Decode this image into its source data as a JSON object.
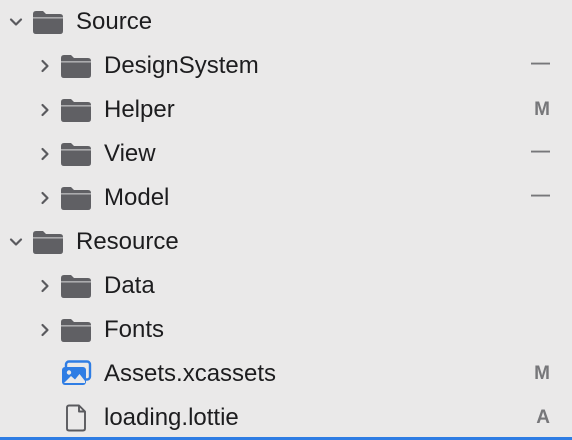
{
  "navigator": {
    "rows": [
      {
        "label": "Source",
        "status": "",
        "icon": "folder-icon",
        "expanded": true
      },
      {
        "label": "DesignSystem",
        "status": "—",
        "icon": "folder-icon",
        "expanded": false
      },
      {
        "label": "Helper",
        "status": "M",
        "icon": "folder-icon",
        "expanded": false
      },
      {
        "label": "View",
        "status": "—",
        "icon": "folder-icon",
        "expanded": false
      },
      {
        "label": "Model",
        "status": "—",
        "icon": "folder-icon",
        "expanded": false
      },
      {
        "label": "Resource",
        "status": "",
        "icon": "folder-icon",
        "expanded": true
      },
      {
        "label": "Data",
        "status": "",
        "icon": "folder-icon",
        "expanded": false
      },
      {
        "label": "Fonts",
        "status": "",
        "icon": "folder-icon",
        "expanded": false
      },
      {
        "label": "Assets.xcassets",
        "status": "M",
        "icon": "asset-catalog-icon"
      },
      {
        "label": "loading.lottie",
        "status": "A",
        "icon": "document-icon"
      }
    ]
  },
  "colors": {
    "background": "#eae9e9",
    "folder": "#606064",
    "asset_catalog": "#2f7de4",
    "status": "#77777a",
    "selection_line": "#2f7de4"
  }
}
